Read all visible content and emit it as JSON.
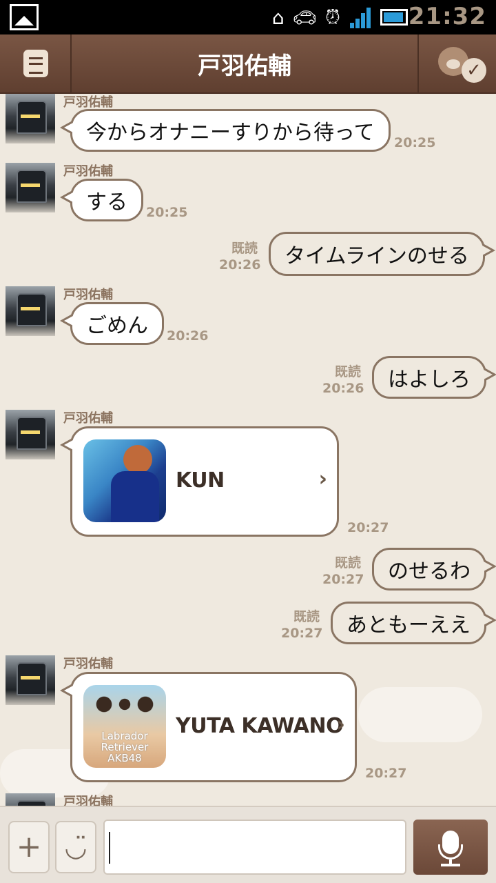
{
  "status_bar": {
    "time": "21:32",
    "icons": [
      "gallery-icon",
      "voicemail-icon",
      "car-icon",
      "alarm-icon",
      "signal-icon",
      "battery-icon"
    ],
    "network": "H"
  },
  "header": {
    "title": "戸羽佑輔",
    "menu_icon": "menu-icon",
    "friend_icon": "bear-check-icon"
  },
  "messages": [
    {
      "side": "left",
      "sender": "戸羽佑輔",
      "text": "今からオナニーすりから待って",
      "time": "20:25"
    },
    {
      "side": "left",
      "sender": "戸羽佑輔",
      "text": "する",
      "time": "20:25"
    },
    {
      "side": "right",
      "read": "既読",
      "text": "タイムラインのせる",
      "time": "20:26"
    },
    {
      "side": "left",
      "sender": "戸羽佑輔",
      "text": "ごめん",
      "time": "20:26"
    },
    {
      "side": "right",
      "read": "既読",
      "text": "はよしろ",
      "time": "20:26"
    },
    {
      "side": "left",
      "sender": "戸羽佑輔",
      "type": "contact",
      "contact_name": "KUN",
      "time": "20:27"
    },
    {
      "side": "right",
      "read": "既読",
      "text": "のせるわ",
      "time": "20:27"
    },
    {
      "side": "right",
      "read": "既読",
      "text": "あともーええ",
      "time": "20:27"
    },
    {
      "side": "left",
      "sender": "戸羽佑輔",
      "type": "contact",
      "contact_name": "YUTA KAWANO",
      "thumb_text": "Labrador Retriever AKB48",
      "time": "20:27"
    },
    {
      "side": "left",
      "sender": "戸羽佑輔"
    }
  ],
  "input_bar": {
    "plus_label": "+",
    "sticker_label": "◡̈",
    "text_value": ""
  },
  "colors": {
    "header_brown": "#6b4838",
    "chat_bg": "#efe9df",
    "bubble_border": "#8a7563",
    "timestamp": "#a89784"
  }
}
